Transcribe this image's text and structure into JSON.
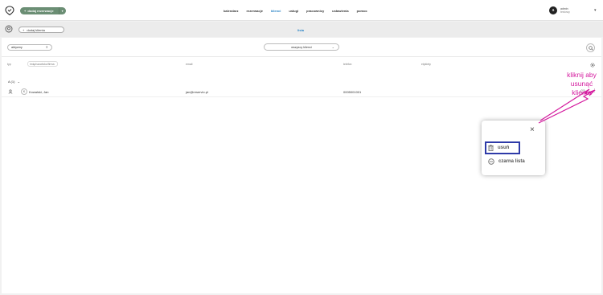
{
  "topbar": {
    "add_reservation": "dodaj rezerwacje",
    "nav": [
      "kalendarz",
      "rezerwacje",
      "klienci",
      "usługi",
      "pracownicy",
      "ustawienia",
      "pomoc"
    ],
    "active_nav": "klienci",
    "user": {
      "avatar_letter": "a",
      "name": "admin",
      "sub": "testowy"
    }
  },
  "subbar": {
    "add_client": "dodaj klienta",
    "view_title": "lista"
  },
  "filters": {
    "filter_value": "aktywny",
    "clients_filter": "wszyscy klienci"
  },
  "table": {
    "columns": {
      "type": "typ",
      "name": "imię/nazwisko/firma",
      "email": "email",
      "phone": "telefon",
      "tags": "etykiety"
    },
    "group_label": "A (1)",
    "rows": [
      {
        "avatar": "K",
        "name": "Kowalski, Jan",
        "email": "jan@reservio.pl",
        "phone": "0005001001"
      }
    ]
  },
  "popup": {
    "delete": "usuń",
    "blacklist": "czarna lista"
  },
  "annotation": {
    "line1": "kliknij aby",
    "line2": "usunąć klienta"
  },
  "colors": {
    "accent": "#2a84c6",
    "brand_green": "#6b8e74",
    "annotation": "#d41a9e",
    "highlight_box": "#2e3aa8"
  }
}
